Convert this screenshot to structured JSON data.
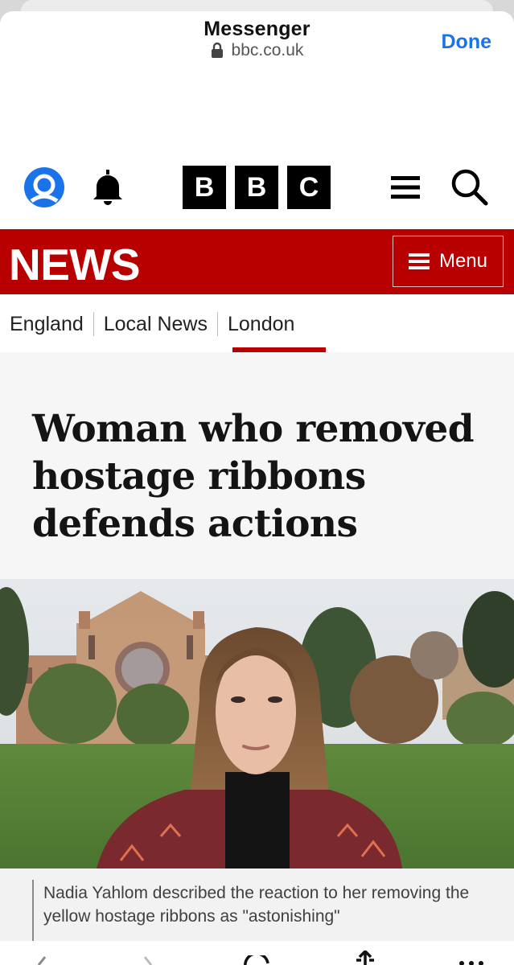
{
  "browser": {
    "title": "Messenger",
    "url": "bbc.co.uk",
    "done_label": "Done"
  },
  "header": {
    "logo_letters": [
      "B",
      "B",
      "C"
    ]
  },
  "news_bar": {
    "logo": "NEWS",
    "menu_label": "Menu"
  },
  "nav": {
    "items": [
      "England",
      "Local News",
      "London"
    ],
    "active": "London"
  },
  "article": {
    "headline": "Woman who removed hostage ribbons defends actions",
    "caption": "Nadia Yahlom described the reaction to her removing the yellow hostage ribbons as \"astonishing\""
  },
  "colors": {
    "bbc_red": "#b80000",
    "done_blue": "#1a73e8",
    "account_blue": "#1a73e8"
  },
  "icons": [
    "lock-icon",
    "account-icon",
    "bell-icon",
    "hamburger-icon",
    "search-icon",
    "menu-icon",
    "back-icon",
    "forward-icon",
    "reload-icon",
    "share-icon",
    "more-icon"
  ]
}
